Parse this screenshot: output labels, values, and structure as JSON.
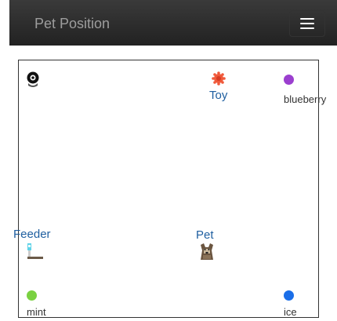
{
  "navbar": {
    "title": "Pet Position",
    "menu_icon": "hamburger-menu-icon"
  },
  "map": {
    "camera": {
      "icon": "camera-icon"
    },
    "toy": {
      "label": "Toy",
      "icon": "toy-ball-icon",
      "color": "#f0593a"
    },
    "blueberry": {
      "label": "blueberry",
      "color": "#9b3fcf"
    },
    "feeder": {
      "label": "Feeder",
      "icon": "feeder-icon"
    },
    "pet": {
      "label": "Pet",
      "icon": "dog-icon"
    },
    "mint": {
      "label": "mint",
      "color": "#7ad141"
    },
    "ice": {
      "label": "ice",
      "color": "#1a6ee8"
    }
  },
  "colors": {
    "navbar_bg": "#222222",
    "label_blue": "#1f5fa0"
  }
}
